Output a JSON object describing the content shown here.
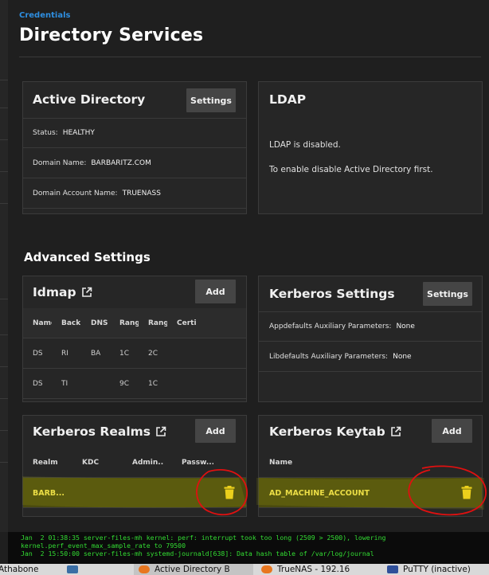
{
  "breadcrumb": "Credentials",
  "page_title": "Directory Services",
  "active_directory": {
    "title": "Active Directory",
    "settings_label": "Settings",
    "rows": [
      {
        "key": "Status:",
        "value": "HEALTHY"
      },
      {
        "key": "Domain Name:",
        "value": "BARBARITZ.COM"
      },
      {
        "key": "Domain Account Name:",
        "value": "TRUENASS"
      }
    ]
  },
  "ldap": {
    "title": "LDAP",
    "line1": "LDAP is disabled.",
    "line2": "To enable disable Active Directory first."
  },
  "advanced_title": "Advanced Settings",
  "idmap": {
    "title": "Idmap",
    "add_label": "Add",
    "columns": [
      "Name",
      "Backe",
      "DNS I",
      "Rang",
      "Rang",
      "Certi"
    ],
    "rows": [
      [
        "DS",
        "RI",
        "BA",
        "1C",
        "2C",
        ""
      ],
      [
        "DS",
        "TI",
        "",
        "9C",
        "1C",
        ""
      ]
    ]
  },
  "kerberos_settings": {
    "title": "Kerberos Settings",
    "settings_label": "Settings",
    "rows": [
      {
        "key": "Appdefaults Auxiliary Parameters:",
        "value": "None"
      },
      {
        "key": "Libdefaults Auxiliary Parameters:",
        "value": "None"
      }
    ]
  },
  "kerberos_realms": {
    "title": "Kerberos Realms",
    "add_label": "Add",
    "columns": [
      "Realm",
      "KDC",
      "Admin...",
      "Passw..."
    ],
    "row": {
      "realm": "BARB..."
    }
  },
  "kerberos_keytab": {
    "title": "Kerberos Keytab",
    "add_label": "Add",
    "column": "Name",
    "row": {
      "name": "AD_MACHINE_ACCOUNT"
    }
  },
  "terminal": {
    "line1": "Jan  2 01:38:35 server-files-mh kernel: perf: interrupt took too long (2509 > 2500), lowering",
    "line2": "kernel.perf_event_max_sample_rate to 79500",
    "line3": "Jan  2 15:50:00 server-files-mh systemd-journald[638]: Data hash table of /var/log/journal"
  },
  "taskbar": {
    "items": [
      "Athabone",
      "",
      "Active Directory B",
      "TrueNAS - 192.16",
      "PuTTY (inactive)"
    ]
  },
  "colors": {
    "accent": "#2e8ee0",
    "highlight_text": "#f0e050",
    "trash": "#f0d020",
    "annotation": "#e01010",
    "terminal_text": "#33dd33"
  }
}
